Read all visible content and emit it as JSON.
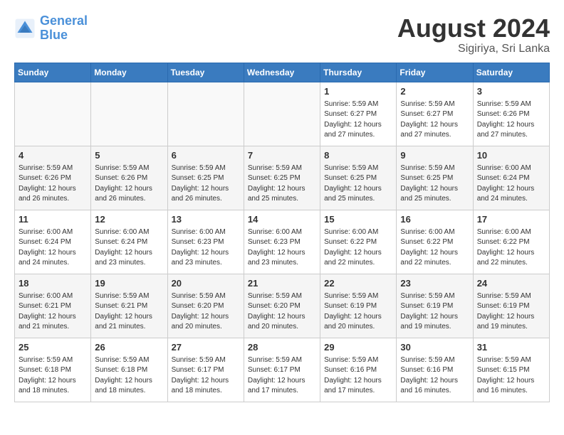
{
  "header": {
    "logo_line1": "General",
    "logo_line2": "Blue",
    "month_year": "August 2024",
    "location": "Sigiriya, Sri Lanka"
  },
  "weekdays": [
    "Sunday",
    "Monday",
    "Tuesday",
    "Wednesday",
    "Thursday",
    "Friday",
    "Saturday"
  ],
  "weeks": [
    [
      {
        "day": "",
        "info": ""
      },
      {
        "day": "",
        "info": ""
      },
      {
        "day": "",
        "info": ""
      },
      {
        "day": "",
        "info": ""
      },
      {
        "day": "1",
        "info": "Sunrise: 5:59 AM\nSunset: 6:27 PM\nDaylight: 12 hours\nand 27 minutes."
      },
      {
        "day": "2",
        "info": "Sunrise: 5:59 AM\nSunset: 6:27 PM\nDaylight: 12 hours\nand 27 minutes."
      },
      {
        "day": "3",
        "info": "Sunrise: 5:59 AM\nSunset: 6:26 PM\nDaylight: 12 hours\nand 27 minutes."
      }
    ],
    [
      {
        "day": "4",
        "info": "Sunrise: 5:59 AM\nSunset: 6:26 PM\nDaylight: 12 hours\nand 26 minutes."
      },
      {
        "day": "5",
        "info": "Sunrise: 5:59 AM\nSunset: 6:26 PM\nDaylight: 12 hours\nand 26 minutes."
      },
      {
        "day": "6",
        "info": "Sunrise: 5:59 AM\nSunset: 6:25 PM\nDaylight: 12 hours\nand 26 minutes."
      },
      {
        "day": "7",
        "info": "Sunrise: 5:59 AM\nSunset: 6:25 PM\nDaylight: 12 hours\nand 25 minutes."
      },
      {
        "day": "8",
        "info": "Sunrise: 5:59 AM\nSunset: 6:25 PM\nDaylight: 12 hours\nand 25 minutes."
      },
      {
        "day": "9",
        "info": "Sunrise: 5:59 AM\nSunset: 6:25 PM\nDaylight: 12 hours\nand 25 minutes."
      },
      {
        "day": "10",
        "info": "Sunrise: 6:00 AM\nSunset: 6:24 PM\nDaylight: 12 hours\nand 24 minutes."
      }
    ],
    [
      {
        "day": "11",
        "info": "Sunrise: 6:00 AM\nSunset: 6:24 PM\nDaylight: 12 hours\nand 24 minutes."
      },
      {
        "day": "12",
        "info": "Sunrise: 6:00 AM\nSunset: 6:24 PM\nDaylight: 12 hours\nand 23 minutes."
      },
      {
        "day": "13",
        "info": "Sunrise: 6:00 AM\nSunset: 6:23 PM\nDaylight: 12 hours\nand 23 minutes."
      },
      {
        "day": "14",
        "info": "Sunrise: 6:00 AM\nSunset: 6:23 PM\nDaylight: 12 hours\nand 23 minutes."
      },
      {
        "day": "15",
        "info": "Sunrise: 6:00 AM\nSunset: 6:22 PM\nDaylight: 12 hours\nand 22 minutes."
      },
      {
        "day": "16",
        "info": "Sunrise: 6:00 AM\nSunset: 6:22 PM\nDaylight: 12 hours\nand 22 minutes."
      },
      {
        "day": "17",
        "info": "Sunrise: 6:00 AM\nSunset: 6:22 PM\nDaylight: 12 hours\nand 22 minutes."
      }
    ],
    [
      {
        "day": "18",
        "info": "Sunrise: 6:00 AM\nSunset: 6:21 PM\nDaylight: 12 hours\nand 21 minutes."
      },
      {
        "day": "19",
        "info": "Sunrise: 5:59 AM\nSunset: 6:21 PM\nDaylight: 12 hours\nand 21 minutes."
      },
      {
        "day": "20",
        "info": "Sunrise: 5:59 AM\nSunset: 6:20 PM\nDaylight: 12 hours\nand 20 minutes."
      },
      {
        "day": "21",
        "info": "Sunrise: 5:59 AM\nSunset: 6:20 PM\nDaylight: 12 hours\nand 20 minutes."
      },
      {
        "day": "22",
        "info": "Sunrise: 5:59 AM\nSunset: 6:19 PM\nDaylight: 12 hours\nand 20 minutes."
      },
      {
        "day": "23",
        "info": "Sunrise: 5:59 AM\nSunset: 6:19 PM\nDaylight: 12 hours\nand 19 minutes."
      },
      {
        "day": "24",
        "info": "Sunrise: 5:59 AM\nSunset: 6:19 PM\nDaylight: 12 hours\nand 19 minutes."
      }
    ],
    [
      {
        "day": "25",
        "info": "Sunrise: 5:59 AM\nSunset: 6:18 PM\nDaylight: 12 hours\nand 18 minutes."
      },
      {
        "day": "26",
        "info": "Sunrise: 5:59 AM\nSunset: 6:18 PM\nDaylight: 12 hours\nand 18 minutes."
      },
      {
        "day": "27",
        "info": "Sunrise: 5:59 AM\nSunset: 6:17 PM\nDaylight: 12 hours\nand 18 minutes."
      },
      {
        "day": "28",
        "info": "Sunrise: 5:59 AM\nSunset: 6:17 PM\nDaylight: 12 hours\nand 17 minutes."
      },
      {
        "day": "29",
        "info": "Sunrise: 5:59 AM\nSunset: 6:16 PM\nDaylight: 12 hours\nand 17 minutes."
      },
      {
        "day": "30",
        "info": "Sunrise: 5:59 AM\nSunset: 6:16 PM\nDaylight: 12 hours\nand 16 minutes."
      },
      {
        "day": "31",
        "info": "Sunrise: 5:59 AM\nSunset: 6:15 PM\nDaylight: 12 hours\nand 16 minutes."
      }
    ]
  ]
}
